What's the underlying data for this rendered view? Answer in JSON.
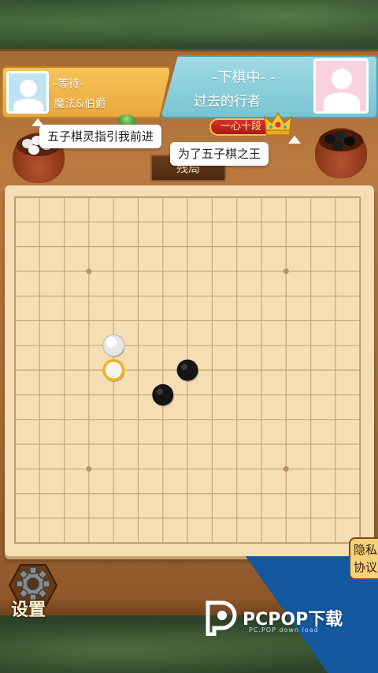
{
  "player_left": {
    "status": "-等待-",
    "name": "魔法&伯爵"
  },
  "player_right": {
    "status": "-下棋中- -",
    "name": "过去的行者",
    "rank": "一心十段"
  },
  "bubbles": {
    "left": "五子棋灵指引我前进",
    "right": "为了五子棋之王"
  },
  "mode_sign": "残局",
  "settings_label": "设置",
  "privacy_label": "隐私协议",
  "watermark": {
    "main": "PCPOP下载",
    "sub": "PC.POP  down load"
  },
  "board": {
    "size": 15,
    "star_points": [
      [
        3,
        3
      ],
      [
        11,
        3
      ],
      [
        3,
        11
      ],
      [
        11,
        11
      ]
    ],
    "stones": [
      {
        "col": 4,
        "row": 6,
        "color": "white"
      },
      {
        "col": 4,
        "row": 7,
        "color": "white",
        "last_move": true
      },
      {
        "col": 7,
        "row": 7,
        "color": "black"
      },
      {
        "col": 6,
        "row": 8,
        "color": "black"
      }
    ]
  },
  "colors": {
    "board": "#f5ddb4",
    "grid": "#c9a878",
    "highlight": "#f2b21e"
  }
}
